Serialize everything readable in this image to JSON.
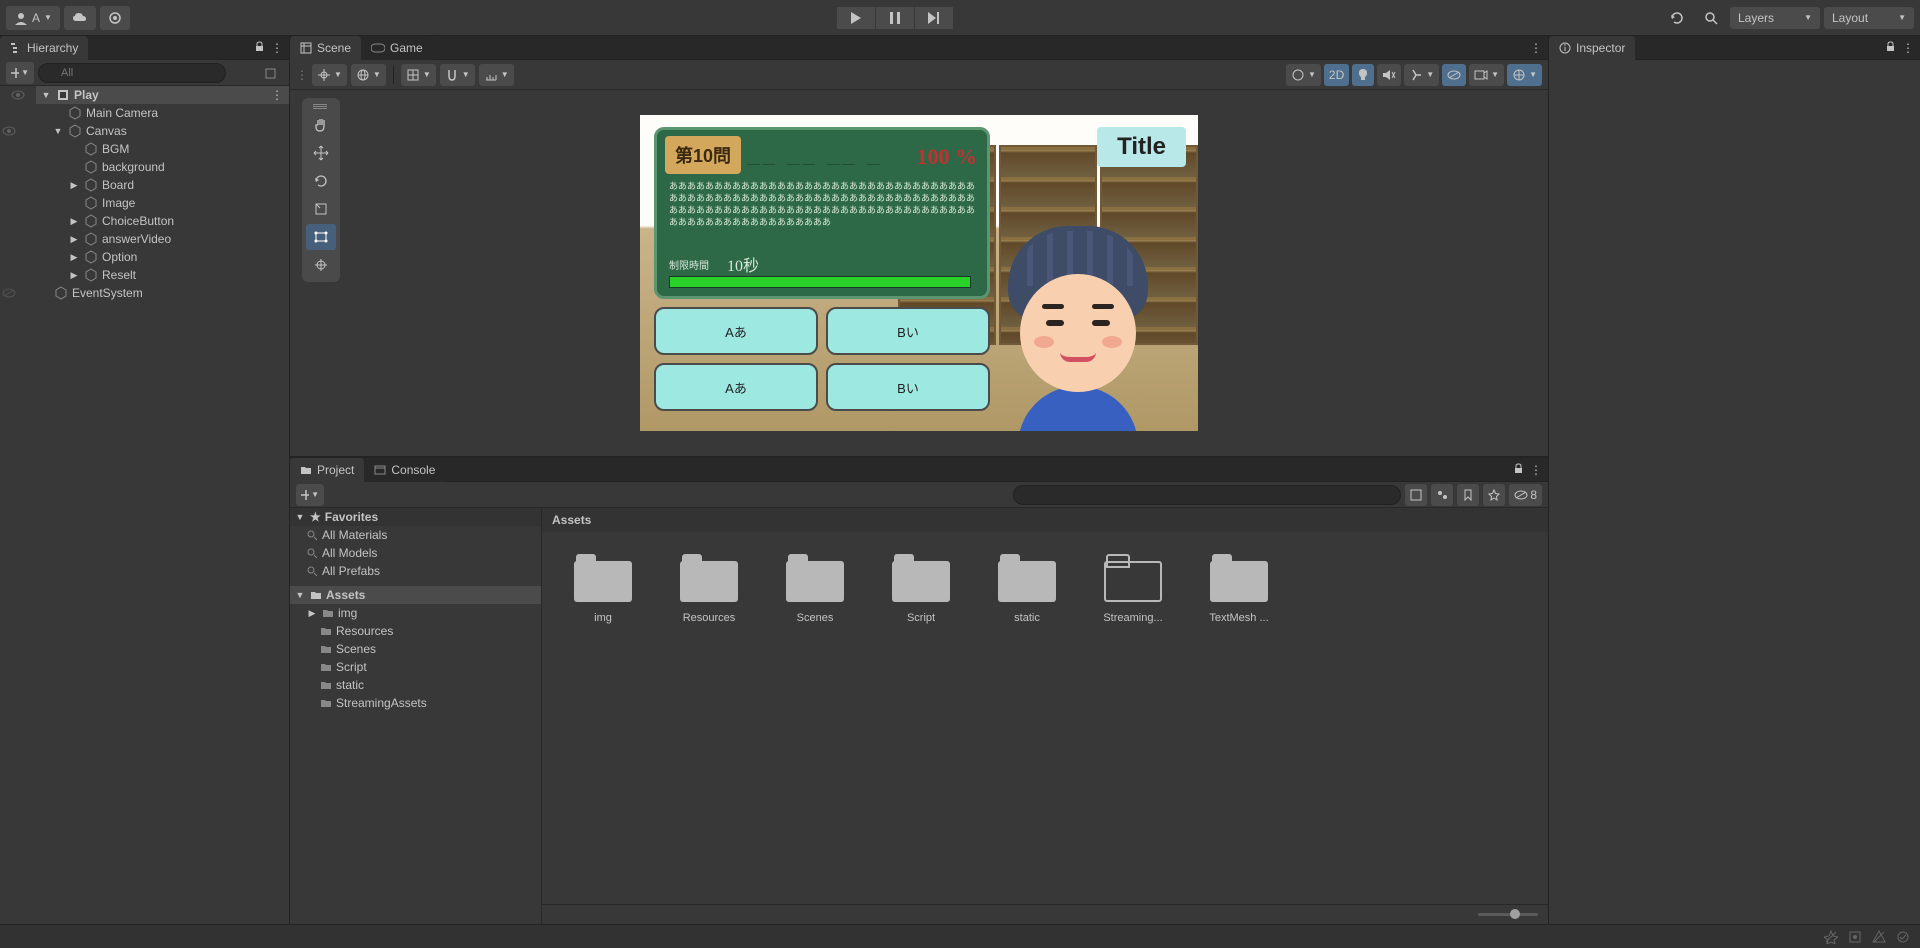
{
  "toolbar": {
    "account_label": "A",
    "layers_label": "Layers",
    "layout_label": "Layout"
  },
  "hierarchy": {
    "title": "Hierarchy",
    "search_placeholder": "All",
    "tree": [
      {
        "label": "Play",
        "depth": 0,
        "expanded": true,
        "icon": "scene",
        "selected": true
      },
      {
        "label": "Main Camera",
        "depth": 1,
        "expanded": null,
        "icon": "go"
      },
      {
        "label": "Canvas",
        "depth": 1,
        "expanded": true,
        "icon": "go"
      },
      {
        "label": "BGM",
        "depth": 2,
        "expanded": null,
        "icon": "go"
      },
      {
        "label": "background",
        "depth": 2,
        "expanded": null,
        "icon": "go"
      },
      {
        "label": "Board",
        "depth": 2,
        "expanded": false,
        "icon": "go"
      },
      {
        "label": "Image",
        "depth": 2,
        "expanded": null,
        "icon": "go"
      },
      {
        "label": "ChoiceButton",
        "depth": 2,
        "expanded": false,
        "icon": "go"
      },
      {
        "label": "answerVideo",
        "depth": 2,
        "expanded": false,
        "icon": "go"
      },
      {
        "label": "Option",
        "depth": 2,
        "expanded": false,
        "icon": "go"
      },
      {
        "label": "Reselt",
        "depth": 2,
        "expanded": false,
        "icon": "go"
      },
      {
        "label": "EventSystem",
        "depth": 1,
        "expanded": null,
        "icon": "go"
      }
    ]
  },
  "scene": {
    "tab_scene": "Scene",
    "tab_game": "Game",
    "mode_2d": "2D"
  },
  "game_preview": {
    "title_badge": "Title",
    "question_label": "第10問",
    "score_dashes": "＿＿ ＿＿ ＿＿ ＿",
    "score_pct": "100 %",
    "question_text": "ああああああああああああああああああああああああああああああああああああああああああああああああああああああああああああああああああああああああああああああああああああああああああああああああああああああああああああああああああああああああ",
    "timer_label": "制限時間",
    "timer_value": "10秒",
    "choices": [
      "Aあ",
      "Bい",
      "Aあ",
      "Bい"
    ]
  },
  "inspector": {
    "title": "Inspector"
  },
  "project": {
    "tab_project": "Project",
    "tab_console": "Console",
    "slider_value": "8",
    "tree": {
      "favorites": "Favorites",
      "all_materials": "All Materials",
      "all_models": "All Models",
      "all_prefabs": "All Prefabs",
      "assets": "Assets",
      "folders": [
        "img",
        "Resources",
        "Scenes",
        "Script",
        "static",
        "StreamingAssets"
      ]
    },
    "breadcrumb": "Assets",
    "grid": [
      "img",
      "Resources",
      "Scenes",
      "Script",
      "static",
      "Streaming...",
      "TextMesh ..."
    ]
  }
}
